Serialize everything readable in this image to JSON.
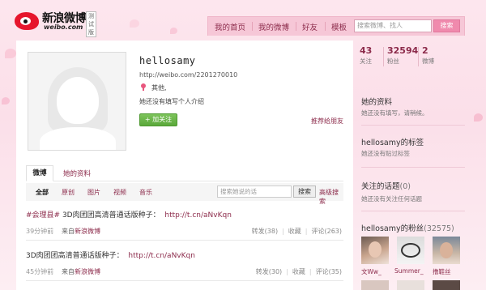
{
  "header": {
    "logo_text": "新浪微博",
    "logo_domain": "weibo.com",
    "beta_label": "测试版",
    "nav": [
      "我的首页",
      "我的微博",
      "好友",
      "模板"
    ],
    "search_placeholder": "搜索微博、找人",
    "search_button": "搜索"
  },
  "profile": {
    "username": "hellosamy",
    "url": "http://weibo.com/2201270010",
    "location": "其他,",
    "bio": "她还没有填写个人介绍",
    "follow_button": "+ 加关注",
    "recommend_link": "推荐给朋友"
  },
  "tabs": [
    "微博",
    "她的资料"
  ],
  "filters": [
    "全部",
    "原创",
    "图片",
    "视频",
    "音乐"
  ],
  "feed_search": {
    "placeholder": "搜索她说的话",
    "button": "搜索",
    "advanced": "高级搜索"
  },
  "posts": [
    {
      "tag": "#会理县#",
      "text": " 3D肉团团高清普通话版种子：",
      "link": "http://t.cn/aNvKqn",
      "time": "39分钟前",
      "source_prefix": "来自",
      "source": "新浪微博",
      "repost": "转发(38)",
      "favorite": "收藏",
      "comment": "评论(263)"
    },
    {
      "tag": "",
      "text": "3D肉团团高清普通话版种子：",
      "link": "http://t.cn/aNvKqn",
      "time": "45分钟前",
      "source_prefix": "来自",
      "source": "新浪微博",
      "repost": "转发(30)",
      "favorite": "收藏",
      "comment": "评论(35)"
    }
  ],
  "stats": [
    {
      "num": "43",
      "label": "关注"
    },
    {
      "num": "32594",
      "label": "粉丝"
    },
    {
      "num": "2",
      "label": "微博"
    }
  ],
  "sidebar": {
    "info_title": "她的资料",
    "info_note": "她还没有填写，请稍候。",
    "tags_title": "hellosamy的标签",
    "tags_note": "她还没有贴过标签",
    "topics_title": "关注的话题",
    "topics_count": "(0)",
    "topics_note": "她还没有关注任何话题",
    "fans_title": "hellosamy的粉丝",
    "fans_count": "(32575)",
    "fans": [
      "文Ww_",
      "Summer_",
      "撸鞋丝"
    ]
  }
}
